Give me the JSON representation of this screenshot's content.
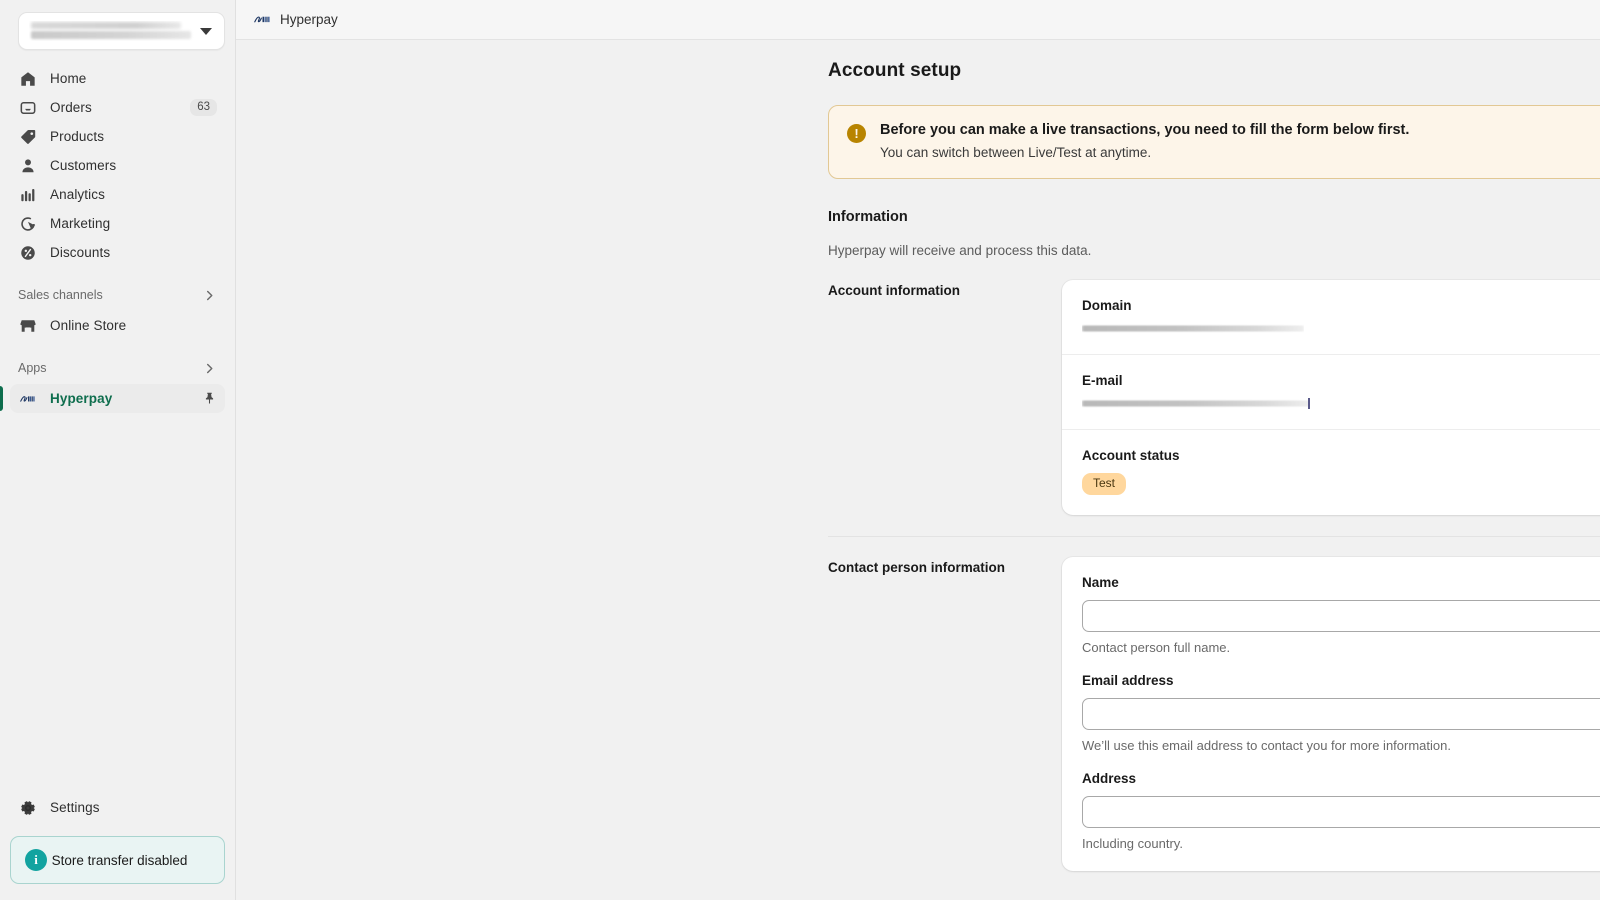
{
  "sidebar": {
    "store_switcher": {
      "name": "store-switcher",
      "value_redacted": true
    },
    "nav_items": [
      {
        "label": "Home",
        "icon": "home-icon",
        "count": ""
      },
      {
        "label": "Orders",
        "icon": "orders-icon",
        "count": "63"
      },
      {
        "label": "Products",
        "icon": "products-tag-icon",
        "count": ""
      },
      {
        "label": "Customers",
        "icon": "customers-person-icon",
        "count": ""
      },
      {
        "label": "Analytics",
        "icon": "analytics-bars-icon",
        "count": ""
      },
      {
        "label": "Marketing",
        "icon": "marketing-target-icon",
        "count": ""
      },
      {
        "label": "Discounts",
        "icon": "discounts-percent-icon",
        "count": ""
      }
    ],
    "sales_channels": {
      "label": "Sales channels",
      "chevron": "chevron-right-icon"
    },
    "online_store": {
      "label": "Online Store",
      "icon": "storefront-icon"
    },
    "apps": {
      "label": "Apps",
      "chevron": "chevron-right-icon"
    },
    "app_item": {
      "label": "Hyperpay",
      "icon": "hyperpay-logo-icon",
      "pin": "pin-icon",
      "active": true
    },
    "settings": {
      "label": "Settings",
      "icon": "gear-icon"
    },
    "transfer_banner": {
      "label": "Store transfer disabled",
      "icon": "info-icon"
    }
  },
  "topbar": {
    "app_name": "Hyperpay",
    "app_logo": "hyperpay-logo-icon"
  },
  "page": {
    "title": "Account setup"
  },
  "banner": {
    "icon": "alert-warning-icon",
    "title": "Before you can make a live transactions, you need to fill the form below first.",
    "subtitle": "You can switch between Live/Test at anytime."
  },
  "information": {
    "heading": "Information",
    "subtext": "Hyperpay will receive and process this data."
  },
  "account_information": {
    "row_label": "Account information",
    "fields": {
      "domain": {
        "label": "Domain",
        "value": "",
        "redacted": true
      },
      "email": {
        "label": "E-mail",
        "value": "",
        "redacted": true
      },
      "account_status": {
        "label": "Account status",
        "badge": "Test"
      }
    }
  },
  "contact_person_information": {
    "row_label": "Contact person information",
    "fields": [
      {
        "label": "Name",
        "value": "",
        "placeholder": "",
        "help": "Contact person full name."
      },
      {
        "label": "Email address",
        "value": "",
        "placeholder": "",
        "help": "We’ll use this email address to contact you for more information."
      },
      {
        "label": "Address",
        "value": "",
        "placeholder": "",
        "help": "Including country."
      }
    ]
  },
  "colors": {
    "accent_green": "#0f6e4e",
    "banner_bg": "#fdf5e9",
    "banner_border": "#e2c894",
    "warn_icon": "#b88400",
    "badge_test_bg": "#ffd79d",
    "info_teal": "#12a3a0",
    "sidebar_bg": "#f1f1f1"
  }
}
